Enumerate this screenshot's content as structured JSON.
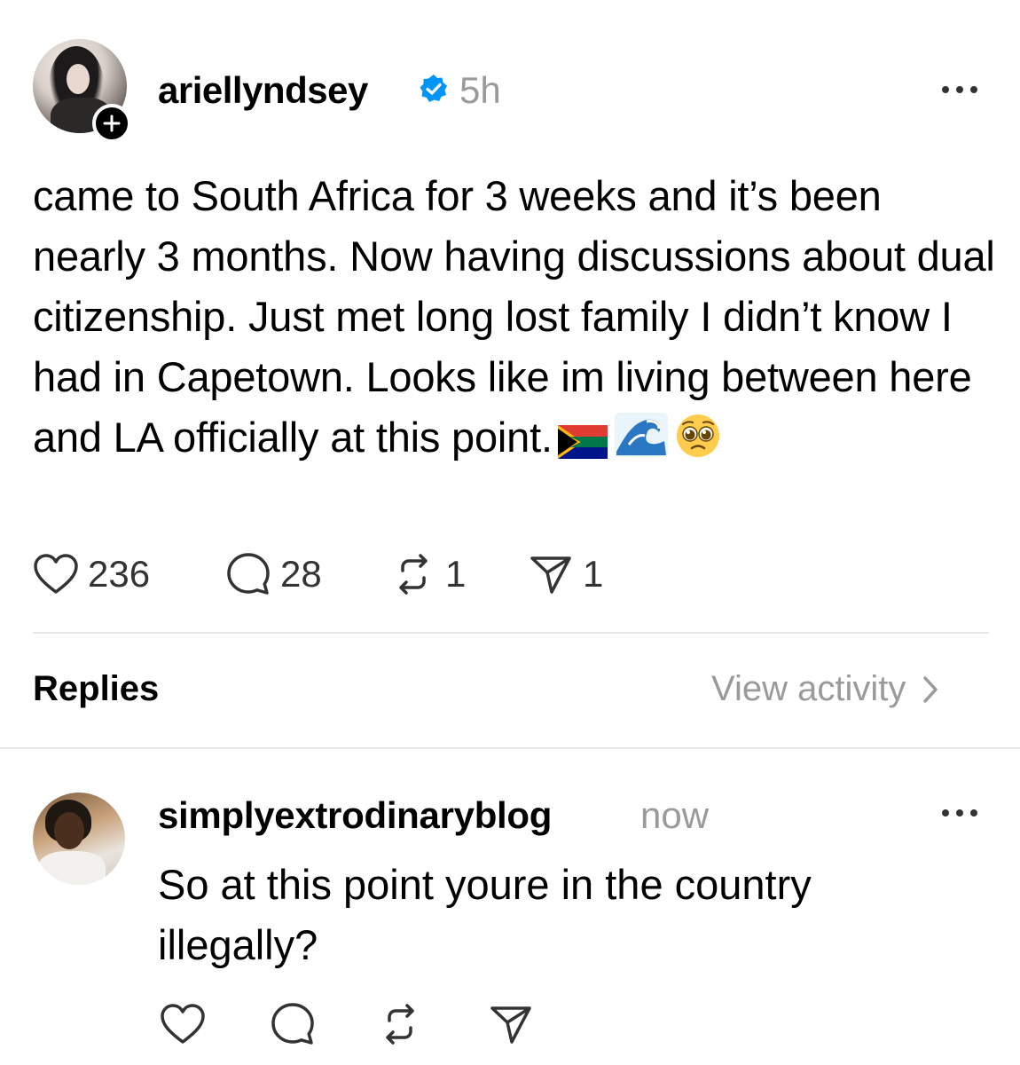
{
  "post": {
    "username": "ariellyndsey",
    "time": "5h",
    "text": "came to South Africa for 3 weeks and it’s been nearly 3 months. Now having discussions about dual citizenship. Just met long lost family I didn’t know I had in Capetown. Looks like im living between here and LA officially at this point.",
    "emojis": [
      "south-africa-flag",
      "wave-emoji",
      "pleading-face-emoji"
    ],
    "stats": {
      "likes": "236",
      "comments": "28",
      "reposts": "1",
      "shares": "1"
    }
  },
  "replies_section": {
    "title": "Replies",
    "view_activity": "View activity"
  },
  "reply": {
    "username": "simplyextrodinaryblog",
    "time": "now",
    "text": "So at this point youre in the country illegally?"
  },
  "colors": {
    "verified": "#0095f6",
    "muted_text": "#9a9a9a",
    "divider": "#e6e6e6"
  }
}
